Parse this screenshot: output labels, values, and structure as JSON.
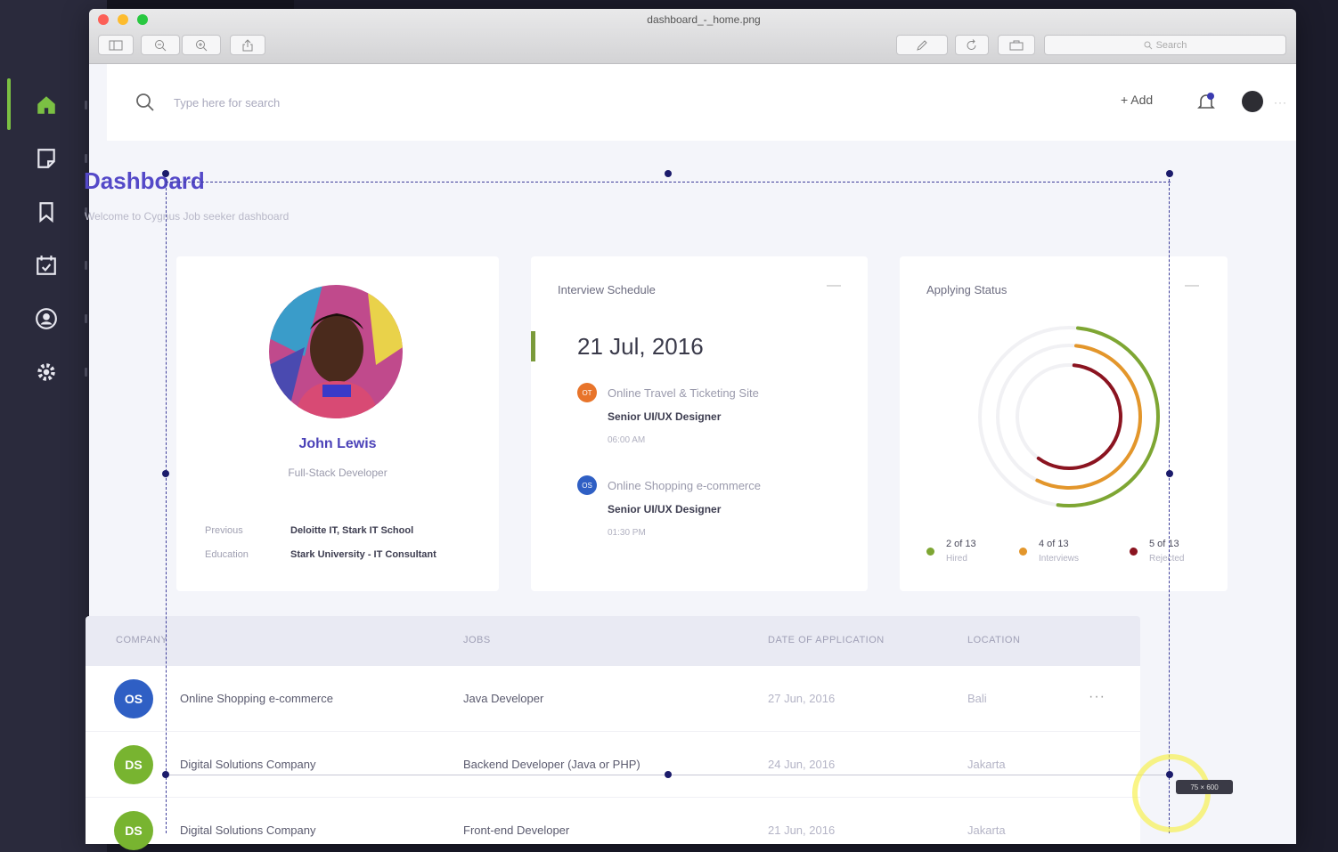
{
  "window": {
    "title": "dashboard_-_home.png",
    "search_placeholder": "Search"
  },
  "header": {
    "search_placeholder": "Type here for search",
    "add_label": "+ Add",
    "more": "···"
  },
  "page": {
    "title": "Dashboard",
    "subtitle": "Welcome to Cygnus Job seeker dashboard"
  },
  "profile": {
    "name": "John Lewis",
    "role": "Full-Stack Developer",
    "details": [
      {
        "label": "Previous",
        "value": "Deloitte IT, Stark IT School"
      },
      {
        "label": "Education",
        "value": "Stark University - IT Consultant"
      }
    ]
  },
  "schedule": {
    "title": "Interview Schedule",
    "menu": "—",
    "date": "21 Jul, 2016",
    "items": [
      {
        "initials": "OT",
        "company": "Online Travel & Ticketing Site",
        "role": "Senior UI/UX Designer",
        "time": "06:00 AM",
        "color": "#e8742a"
      },
      {
        "initials": "OS",
        "company": "Online Shopping e-commerce",
        "role": "Senior UI/UX Designer",
        "time": "01:30 PM",
        "color": "#2f5fc4"
      }
    ]
  },
  "status": {
    "title": "Applying Status",
    "menu": "—",
    "rings": [
      {
        "name": "Hired",
        "value": 2,
        "total": 13,
        "count_text": "2 of 13",
        "color": "#7ea633"
      },
      {
        "name": "Interviews",
        "value": 4,
        "total": 13,
        "count_text": "4 of 13",
        "color": "#e3962b"
      },
      {
        "name": "Rejected",
        "value": 5,
        "total": 13,
        "count_text": "5 of 13",
        "color": "#8b1420"
      }
    ]
  },
  "table": {
    "columns": [
      "COMPANY",
      "JOBS",
      "DATE OF APPLICATION",
      "LOCATION"
    ],
    "rows": [
      {
        "initials": "OS",
        "company": "Online Shopping e-commerce",
        "job": "Java Developer",
        "date": "27 Jun, 2016",
        "location": "Bali",
        "color": "#2f5fc4",
        "more": "···"
      },
      {
        "initials": "DS",
        "company": "Digital Solutions Company",
        "job": "Backend Developer (Java or PHP)",
        "date": "24 Jun, 2016",
        "location": "Jakarta",
        "color": "#78b430",
        "more": ""
      },
      {
        "initials": "DS",
        "company": "Digital Solutions Company",
        "job": "Front-end Developer",
        "date": "21 Jun, 2016",
        "location": "Jakarta",
        "color": "#78b430",
        "more": ""
      }
    ]
  },
  "overlay": {
    "tooltip": "75 × 600"
  },
  "colors": {
    "accent": "#5449c8",
    "green": "#7bc043",
    "sidebar": "#2a2a3c"
  },
  "icons": {
    "sidebar": [
      "home-icon",
      "notes-icon",
      "bookmark-icon",
      "calendar-check-icon",
      "user-icon",
      "settings-icon"
    ],
    "header": [
      "search-icon",
      "bell-icon",
      "user-avatar"
    ]
  }
}
